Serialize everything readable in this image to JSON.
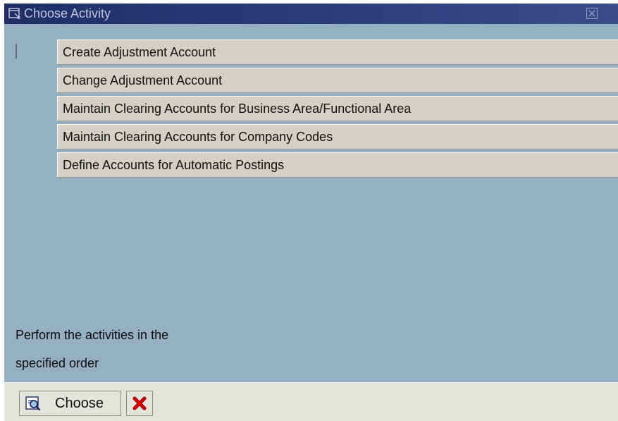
{
  "dialog": {
    "title": "Choose Activity",
    "icons": {
      "title": "window-icon",
      "close": "close-icon"
    }
  },
  "activities": [
    {
      "label": "Create Adjustment Account"
    },
    {
      "label": "Change Adjustment Account"
    },
    {
      "label": "Maintain Clearing Accounts for Business Area/Functional Area"
    },
    {
      "label": "Maintain Clearing Accounts for Company Codes"
    },
    {
      "label": "Define Accounts for Automatic Postings"
    }
  ],
  "hint": {
    "line1": "Perform the activities in the",
    "line2": "specified order"
  },
  "toolbar": {
    "choose_label": "Choose",
    "choose_icon": "choose-icon",
    "cancel_icon": "cancel-icon"
  },
  "colors": {
    "background": "#94b0c2",
    "titlebar": "#1f2e66",
    "activity_button": "#d4d0c7",
    "toolbar": "#e4e3dc",
    "cancel_red": "#d40000"
  }
}
